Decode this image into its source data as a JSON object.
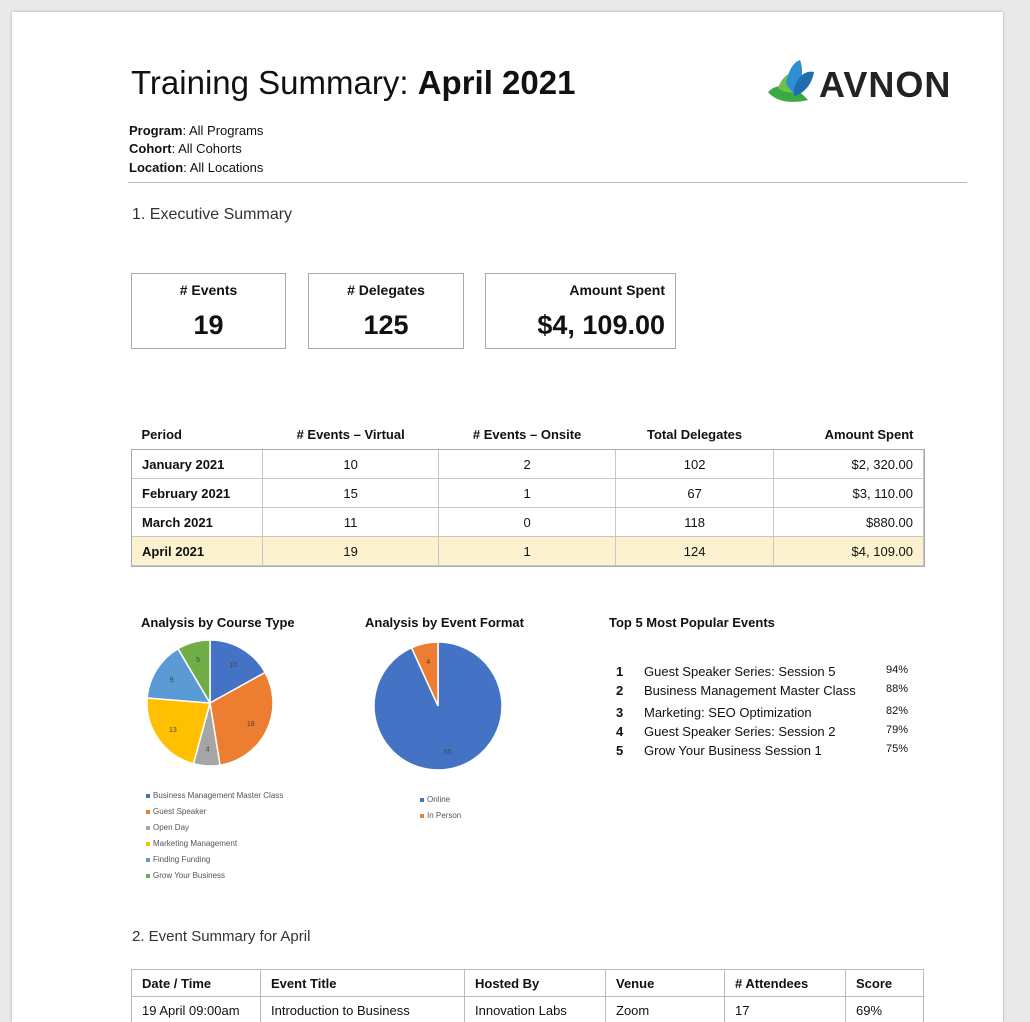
{
  "title": {
    "prefix": "Training Summary:",
    "period": "April 2021"
  },
  "logo": {
    "text": "AVNON"
  },
  "filters": [
    {
      "label": "Program",
      "value": "All Programs"
    },
    {
      "label": "Cohort",
      "value": "All Cohorts"
    },
    {
      "label": "Location",
      "value": "All Locations"
    }
  ],
  "section1": "1. Executive Summary",
  "kpis": [
    {
      "label": "# Events",
      "value": "19"
    },
    {
      "label": "# Delegates",
      "value": "125"
    },
    {
      "label": "Amount Spent",
      "value": "$4, 109.00"
    }
  ],
  "period_table": {
    "headers": [
      "Period",
      "# Events – Virtual",
      "# Events – Onsite",
      "Total Delegates",
      "Amount Spent"
    ],
    "rows": [
      [
        "January 2021",
        "10",
        "2",
        "102",
        "$2, 320.00"
      ],
      [
        "February 2021",
        "15",
        "1",
        "67",
        "$3, 110.00"
      ],
      [
        "March 2021",
        "11",
        "0",
        "118",
        "$880.00"
      ],
      [
        "April 2021",
        "19",
        "1",
        "124",
        "$4, 109.00"
      ]
    ]
  },
  "chart_data": [
    {
      "type": "pie",
      "title": "Analysis by Course Type",
      "categories": [
        "Business Management Master Class",
        "Guest Speaker",
        "Open Day",
        "Marketing Management",
        "Finding Funding",
        "Grow Your Business"
      ],
      "values": [
        10,
        18,
        4,
        13,
        9,
        5
      ],
      "colors": [
        "#4472c4",
        "#ed7d31",
        "#a5a5a5",
        "#ffc000",
        "#5b9bd5",
        "#70ad47"
      ]
    },
    {
      "type": "pie",
      "title": "Analysis by Event Format",
      "categories": [
        "Online",
        "In Person"
      ],
      "values": [
        55,
        4
      ],
      "colors": [
        "#4472c4",
        "#ed7d31"
      ]
    }
  ],
  "top5": {
    "title": "Top 5 Most Popular Events",
    "items": [
      {
        "rank": "1",
        "name": "Guest Speaker Series: Session 5",
        "pct": "94%"
      },
      {
        "rank": "2",
        "name": "Business Management Master Class",
        "pct": "88%"
      },
      {
        "rank": "3",
        "name": "Marketing: SEO Optimization",
        "pct": "82%"
      },
      {
        "rank": "4",
        "name": "Guest Speaker Series: Session 2",
        "pct": "79%"
      },
      {
        "rank": "5",
        "name": "Grow Your Business Session 1",
        "pct": "75%"
      }
    ]
  },
  "section2": "2. Event Summary for April",
  "event_table": {
    "headers": [
      "Date / Time",
      "Event Title",
      "Hosted By",
      "Venue",
      "# Attendees",
      "Score"
    ],
    "rows": [
      [
        "19 April 09:00am",
        "Introduction to Business",
        "Innovation Labs",
        "Zoom",
        "17",
        "69%"
      ]
    ]
  }
}
